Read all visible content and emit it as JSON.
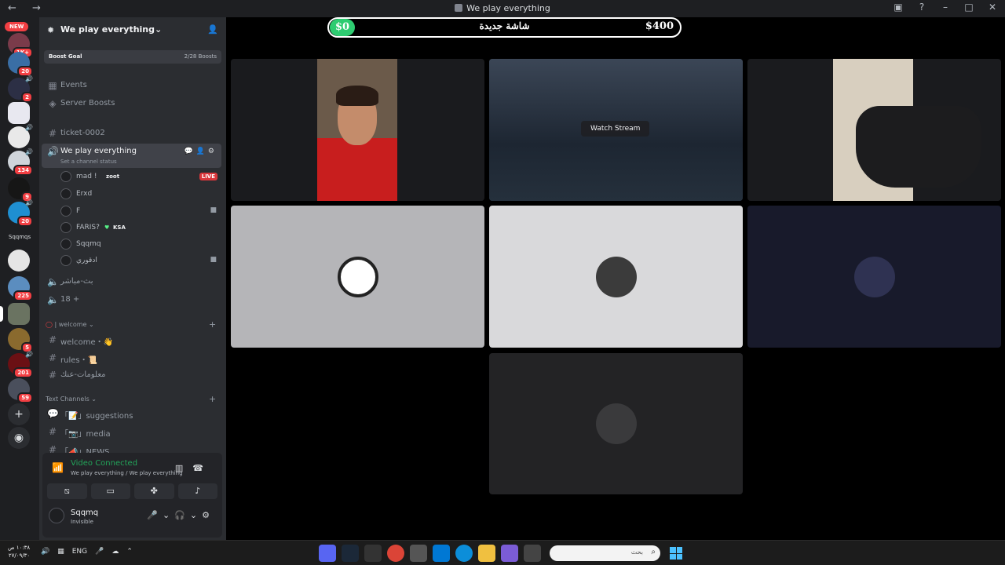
{
  "window": {
    "title": "We play everything",
    "nav_arrows": "← →",
    "right_icons": [
      "screen-share-icon",
      "help-icon",
      "minimize-icon",
      "maximize-icon",
      "close-icon"
    ]
  },
  "servers": {
    "new_label": "NEW",
    "badges": [
      "1K+",
      "20",
      "2",
      "134",
      "9",
      "20",
      "225",
      "5",
      "201",
      "59"
    ],
    "text_server": "Sqqmqs"
  },
  "guild": {
    "name": "We play everything",
    "boost_goal": "Boost Goal",
    "boost_count": "2/28 Boosts"
  },
  "channels": {
    "events": "Events",
    "server_boosts": "Server Boosts",
    "ticket": "ticket-0002",
    "voice_active": "We play everything",
    "voice_status": "Set a channel status",
    "voice_users": [
      {
        "name": "mad !",
        "tag": "zoot",
        "live": "LIVE"
      },
      {
        "name": "Erxd"
      },
      {
        "name": "F"
      },
      {
        "name": "FARIS?",
        "tag": "KSA"
      },
      {
        "name": "Sqqmq"
      },
      {
        "name": "ادقوري"
      }
    ],
    "voice_2": "بث-مباشر",
    "voice_3": "18 +",
    "cat_welcome": "| welcome",
    "welcome": "welcome・👋",
    "rules": "rules・📜",
    "info": "معلومات-عنك",
    "cat_text": "Text Channels",
    "suggestions": "「📝」suggestions",
    "media": "「📷」media",
    "news": "「📣」NEWS"
  },
  "voice_panel": {
    "status": "Video Connected",
    "path": "We play everything / We play everything",
    "user": "Sqqmq",
    "user_status": "Invisible"
  },
  "stage": {
    "goal_current": "$0",
    "goal_title": "شاشة جديدة",
    "goal_target": "$400",
    "watch_stream": "Watch Stream"
  },
  "taskbar": {
    "time": "١٠:٣٨ ص",
    "date": "٢٧/٠٩/٣٠",
    "lang": "ENG",
    "search_placeholder": "بحث"
  }
}
